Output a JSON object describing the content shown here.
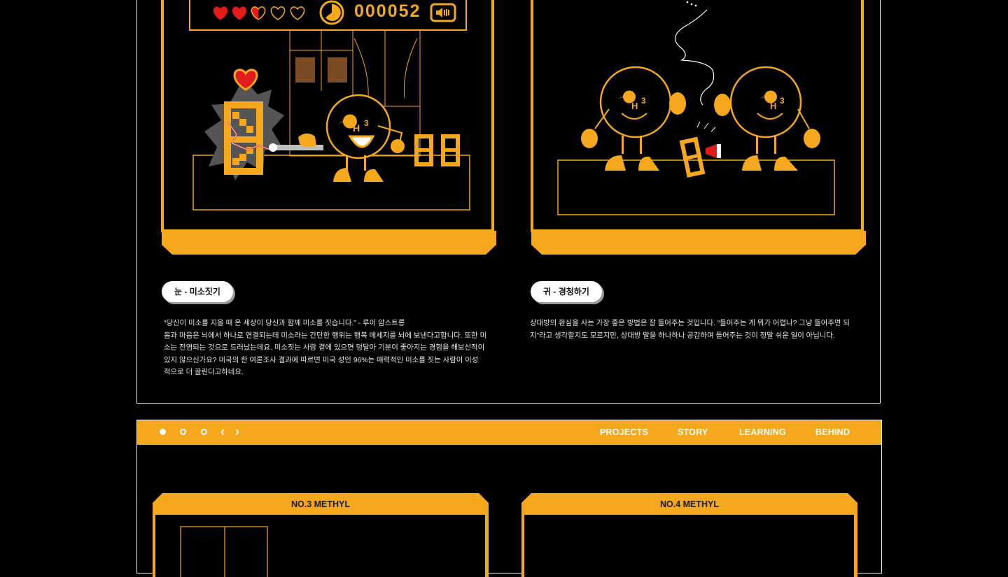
{
  "hud": {
    "score": "000052",
    "hearts": [
      "full",
      "full",
      "half",
      "empty",
      "empty"
    ],
    "icons": [
      "heart-icon",
      "timer-icon",
      "sound-icon"
    ]
  },
  "cards": [
    {
      "label": "눈 - 미소짓기",
      "text": [
        "“당신이 미소를 지을 때  온 세상이 당신과 함께 미소를 짓습니다.” - 루이 암스트롱",
        "몸과 마음은 뇌에서 하나로 연결되는데 미소라는 간단한 행위는 행복 메세지를 뇌에 보낸다고합니다. 또한 미",
        "소는 전염되는 것으로 드러났는데요. 미소짓는 사람 곁에 있으면 덩달아 기분이 좋아지는 경험을 해보신적이",
        "있지 않으신가요? 미국의 한 여론조사 결과에 따르면  미국 성인 96%는 매력적인 미소를 짓는 사람이 이성",
        "적으로 더 끌린다고하네요."
      ]
    },
    {
      "label": "귀 - 경청하기",
      "text": [
        "상대방의 환심을 사는 가장 좋은 방법은 잘 들어주는 것입니다. “들어주는 게 뭐가 어렵나? 그냥 들어주면 되",
        "지”라고 생각할지도 모르지만, 상대방 말을 하나하나 공감하며 들어주는 것이 정말 쉬운 일이 아닙니다."
      ]
    }
  ],
  "nav": {
    "links": [
      "PROJECTS",
      "STORY",
      "LEARNING",
      "BEHIND"
    ],
    "dots": 3,
    "active_dot": 0
  },
  "methyl_cards": [
    {
      "title": "NO.3 METHYL"
    },
    {
      "title": "NO.4 METHYL"
    }
  ],
  "colors": {
    "accent": "#f5a81d",
    "background": "#000000",
    "heart": "#e21b1b"
  }
}
